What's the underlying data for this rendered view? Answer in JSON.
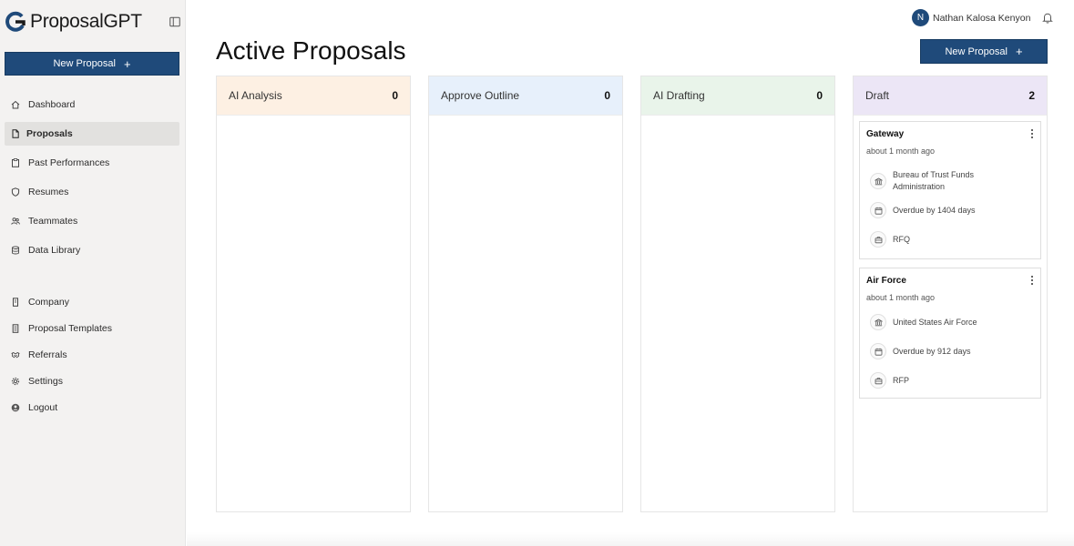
{
  "app": {
    "name": "ProposalGPT"
  },
  "sidebar": {
    "new_button": "New Proposal",
    "items": [
      {
        "label": "Dashboard",
        "icon": "home-icon"
      },
      {
        "label": "Proposals",
        "icon": "document-icon",
        "active": true
      },
      {
        "label": "Past Performances",
        "icon": "clipboard-icon"
      },
      {
        "label": "Resumes",
        "icon": "shield-icon"
      },
      {
        "label": "Teammates",
        "icon": "users-icon"
      },
      {
        "label": "Data Library",
        "icon": "database-icon"
      }
    ],
    "secondary": [
      {
        "label": "Company",
        "icon": "building-icon"
      },
      {
        "label": "Proposal Templates",
        "icon": "template-icon"
      },
      {
        "label": "Referrals",
        "icon": "handshake-icon"
      },
      {
        "label": "Settings",
        "icon": "gear-icon"
      },
      {
        "label": "Logout",
        "icon": "logout-icon"
      }
    ]
  },
  "header": {
    "user_initial": "N",
    "user_name": "Nathan Kalosa Kenyon",
    "title": "Active Proposals",
    "new_button": "New Proposal"
  },
  "colors": {
    "primary": "#1f4a7a",
    "col_ai_analysis": "#fdf0e3",
    "col_approve_outline": "#e7f0fb",
    "col_ai_drafting": "#e9f4ea",
    "col_draft": "#ece6f6"
  },
  "columns": [
    {
      "title": "AI Analysis",
      "count": "0"
    },
    {
      "title": "Approve Outline",
      "count": "0"
    },
    {
      "title": "AI Drafting",
      "count": "0"
    },
    {
      "title": "Draft",
      "count": "2",
      "cards": [
        {
          "title": "Gateway",
          "time": "about 1 month ago",
          "agency": "Bureau of Trust Funds Administration",
          "due": "Overdue by 1404 days",
          "type": "RFQ"
        },
        {
          "title": "Air Force",
          "time": "about 1 month ago",
          "agency": "United States Air Force",
          "due": "Overdue by 912 days",
          "type": "RFP"
        }
      ]
    }
  ]
}
